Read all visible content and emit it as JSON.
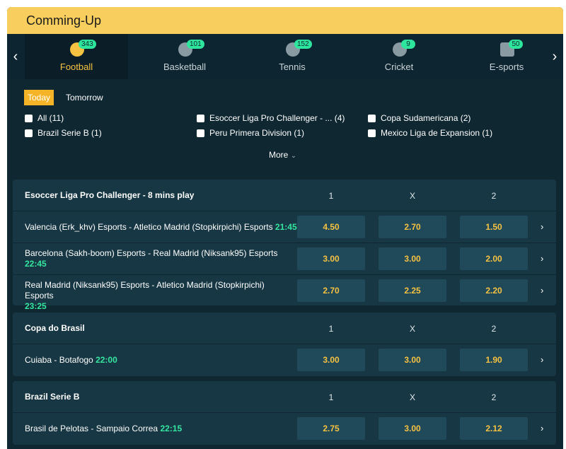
{
  "header": {
    "title": "Comming-Up"
  },
  "tabs": [
    {
      "label": "Football",
      "count": "343",
      "icon": "football-icon",
      "color": "#f5c242"
    },
    {
      "label": "Basketball",
      "count": "101",
      "icon": "basketball-icon",
      "color": "#8a9aa2"
    },
    {
      "label": "Tennis",
      "count": "152",
      "icon": "tennis-icon",
      "color": "#8a9aa2"
    },
    {
      "label": "Cricket",
      "count": "9",
      "icon": "cricket-icon",
      "color": "#8a9aa2"
    },
    {
      "label": "E-sports",
      "count": "50",
      "icon": "esports-icon",
      "color": "#8a9aa2"
    }
  ],
  "nav": {
    "prev": "‹",
    "next": "›"
  },
  "days": {
    "today": "Today",
    "tomorrow": "Tomorrow"
  },
  "leagues": [
    {
      "label": "All (11)"
    },
    {
      "label": "Esoccer Liga Pro Challenger - ... (4)"
    },
    {
      "label": "Copa Sudamericana (2)"
    },
    {
      "label": "Brazil Serie B (1)"
    },
    {
      "label": "Peru Primera Division (1)"
    },
    {
      "label": "Mexico Liga de Expansion (1)"
    }
  ],
  "more": "More",
  "columns": {
    "one": "1",
    "x": "X",
    "two": "2"
  },
  "competitions": [
    {
      "title": "Esoccer Liga Pro Challenger - 8 mins play",
      "matches": [
        {
          "teams": "Valencia (Erk_khv) Esports - Atletico Madrid (Stopkirpichi) Esports",
          "time": "21:45",
          "odds": [
            "4.50",
            "2.70",
            "1.50"
          ]
        },
        {
          "teams": "Barcelona (Sakh-boom) Esports - Real Madrid (Niksank95) Esports",
          "time": "22:45",
          "odds": [
            "3.00",
            "3.00",
            "2.00"
          ]
        },
        {
          "teams": "Real Madrid (Niksank95) Esports - Atletico Madrid (Stopkirpichi) Esports",
          "time": "23:25",
          "odds": [
            "2.70",
            "2.25",
            "2.20"
          ]
        }
      ]
    },
    {
      "title": "Copa do Brasil",
      "matches": [
        {
          "teams": "Cuiaba - Botafogo",
          "time": "22:00",
          "odds": [
            "3.00",
            "3.00",
            "1.90"
          ]
        }
      ]
    },
    {
      "title": "Brazil Serie B",
      "matches": [
        {
          "teams": "Brasil de Pelotas - Sampaio Correa",
          "time": "22:15",
          "odds": [
            "2.75",
            "3.00",
            "2.12"
          ]
        }
      ]
    }
  ]
}
